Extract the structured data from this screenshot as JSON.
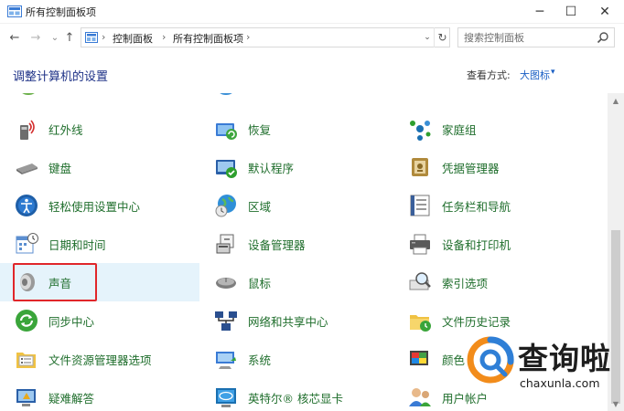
{
  "window": {
    "title": "所有控制面板项",
    "minimize_glyph": "─",
    "maximize_glyph": "☐",
    "close_glyph": "✕"
  },
  "address": {
    "back_glyph": "←",
    "forward_glyph": "→",
    "recent_glyph": "⌄",
    "up_glyph": "↑",
    "sep1": "›",
    "crumb1": "控制面板",
    "sep2": "›",
    "crumb2": "所有控制面板项",
    "sep3": "›",
    "dropdown_glyph": "⌄",
    "refresh_glyph": "↻",
    "search_placeholder": "搜索控制面板"
  },
  "header": {
    "heading": "调整计算机的设置",
    "view_by_label": "查看方式:",
    "view_by_value": "大图标",
    "view_caret": "▾"
  },
  "items": {
    "infrared": "红外线",
    "recovery": "恢复",
    "homegroup": "家庭组",
    "keyboard": "键盘",
    "default_programs": "默认程序",
    "credential_manager": "凭据管理器",
    "ease_of_access": "轻松使用设置中心",
    "region": "区域",
    "taskbar": "任务栏和导航",
    "date_time": "日期和时间",
    "device_manager": "设备管理器",
    "devices_printers": "设备和打印机",
    "sound": "声音",
    "mouse": "鼠标",
    "indexing": "索引选项",
    "sync_center": "同步中心",
    "network_sharing": "网络和共享中心",
    "file_history": "文件历史记录",
    "file_explorer_options": "文件资源管理器选项",
    "system": "系统",
    "color": "颜色",
    "troubleshooting": "疑难解答",
    "intel_graphics": "英特尔® 核芯显卡",
    "user_accounts": "用户帐户"
  },
  "scrollbar": {
    "up_glyph": "▲",
    "down_glyph": "▼"
  },
  "watermark": {
    "text": "查询啦",
    "url": "chaxunla.com"
  },
  "colors": {
    "link_green": "#1f6e2c",
    "heading_blue": "#1e3287",
    "selection": "#e5f3fb",
    "highlight_red": "#e0262a"
  }
}
